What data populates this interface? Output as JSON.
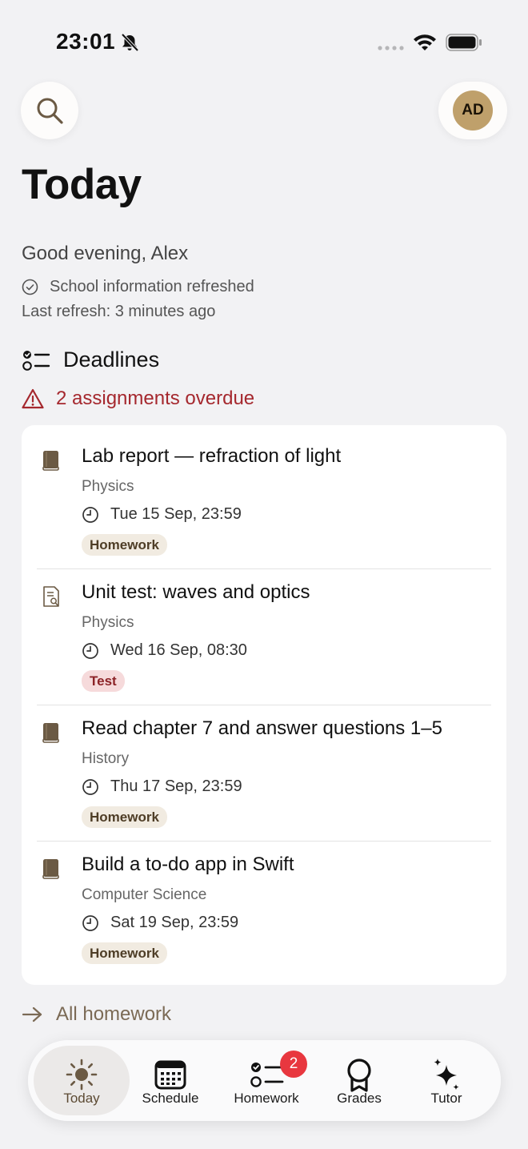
{
  "status": {
    "time": "23:01"
  },
  "header": {
    "title": "Today",
    "avatar_initials": "AD"
  },
  "info": {
    "greeting": "Good evening, Alex",
    "refresh_status": "School information refreshed",
    "last_refresh": "Last refresh: 3 minutes ago"
  },
  "deadlines": {
    "heading": "Deadlines",
    "overdue": "2 assignments overdue",
    "items": [
      {
        "title": "Lab report — refraction of light",
        "subject": "Physics",
        "due": "Tue 15 Sep, 23:59",
        "tag": "Homework",
        "icon": "book-icon"
      },
      {
        "title": "Unit test: waves and optics",
        "subject": "Physics",
        "due": "Wed 16 Sep, 08:30",
        "tag": "Test",
        "icon": "test-document-icon"
      },
      {
        "title": "Read chapter 7 and answer questions 1–5",
        "subject": "History",
        "due": "Thu 17 Sep, 23:59",
        "tag": "Homework",
        "icon": "book-icon"
      },
      {
        "title": "Build a to-do app in Swift",
        "subject": "Computer Science",
        "due": "Sat 19 Sep, 23:59",
        "tag": "Homework",
        "icon": "book-icon"
      }
    ],
    "all_link": "All homework"
  },
  "tabs": [
    {
      "label": "Today",
      "icon": "sun-icon",
      "active": true
    },
    {
      "label": "Schedule",
      "icon": "calendar-icon"
    },
    {
      "label": "Homework",
      "icon": "checklist-icon",
      "badge": "2"
    },
    {
      "label": "Grades",
      "icon": "award-icon"
    },
    {
      "label": "Tutor",
      "icon": "sparkles-icon"
    }
  ],
  "colors": {
    "accent": "#7b6a55",
    "overdue": "#a5282e",
    "badge": "#e8373f",
    "avatar": "#bfa06b"
  }
}
